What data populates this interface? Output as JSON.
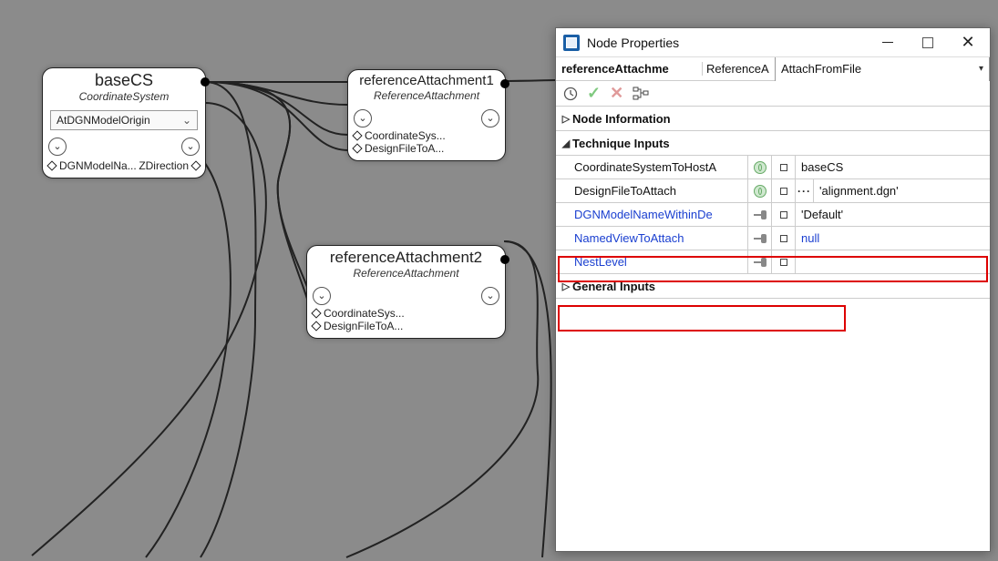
{
  "panel": {
    "title": "Node Properties",
    "selected_node": "referenceAttachme",
    "selected_type": "ReferenceA",
    "selected_action": "AttachFromFile",
    "sections": {
      "node_info": "Node Information",
      "tech_inputs": "Technique Inputs",
      "general_inputs": "General Inputs"
    },
    "props": {
      "coord_label": "CoordinateSystemToHostA",
      "coord_value": "baseCS",
      "design_label": "DesignFileToAttach",
      "design_value": "'alignment.dgn'",
      "dgn_label": "DGNModelNameWithinDe",
      "dgn_value": "'Default'",
      "view_label": "NamedViewToAttach",
      "view_value": "null",
      "nest_label": "NestLevel",
      "nest_value": ""
    }
  },
  "nodes": {
    "baseCS": {
      "title": "baseCS",
      "subtype": "CoordinateSystem",
      "select_value": "AtDGNModelOrigin",
      "left_port": "DGNModelNa...",
      "right_port": "ZDirection"
    },
    "ref1": {
      "title": "referenceAttachment1",
      "subtype": "ReferenceAttachment",
      "port_a": "CoordinateSys...",
      "port_b": "DesignFileToA..."
    },
    "ref2": {
      "title": "referenceAttachment2",
      "subtype": "ReferenceAttachment",
      "port_a": "CoordinateSys...",
      "port_b": "DesignFileToA..."
    }
  }
}
